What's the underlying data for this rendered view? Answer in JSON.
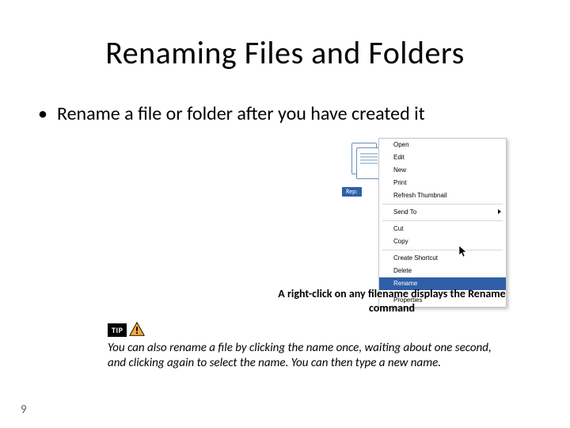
{
  "title": "Renaming Files and Folders",
  "bullet": "Rename a file or folder after you have created it",
  "file_label": "Rep:",
  "context_menu": {
    "open": "Open",
    "edit": "Edit",
    "new": "New",
    "print": "Print",
    "refresh_thumb": "Refresh Thumbnail",
    "send_to": "Send To",
    "cut": "Cut",
    "copy": "Copy",
    "create_shortcut": "Create Shortcut",
    "delete": "Delete",
    "rename": "Rename",
    "properties": "Properties"
  },
  "caption": "A right-click on any filename displays the Rename command",
  "tip_label": "TIP",
  "tip_text": "You can also rename a file by clicking the name once, waiting about one second, and clicking again to select the name. You can then type a new name.",
  "page_number": "9"
}
